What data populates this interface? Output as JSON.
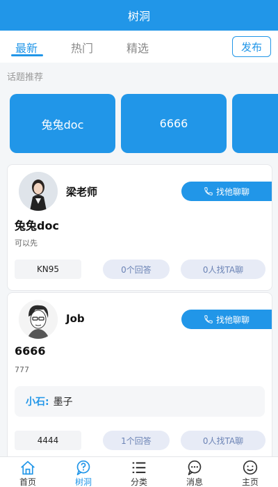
{
  "header": {
    "title": "树洞"
  },
  "tabs": [
    {
      "label": "最新",
      "active": true
    },
    {
      "label": "热门",
      "active": false
    },
    {
      "label": "精选",
      "active": false
    }
  ],
  "publish_label": "发布",
  "topics": {
    "label": "话题推荐",
    "items": [
      "兔兔doc",
      "6666",
      ""
    ]
  },
  "posts": [
    {
      "user": "梁老师",
      "chat_label": "找他聊聊",
      "title": "兔兔doc",
      "desc": "可以先",
      "tag": "KN95",
      "answers": "0个回答",
      "talk": "0人找TA聊"
    },
    {
      "user": "Job",
      "chat_label": "找他聊聊",
      "title": "6666",
      "desc": "777",
      "reply_name": "小石:",
      "reply_text": "墨子",
      "tag": "4444",
      "answers": "1个回答",
      "talk": "0人找TA聊"
    }
  ],
  "nav": [
    {
      "label": "首页",
      "icon": "home-icon"
    },
    {
      "label": "树洞",
      "icon": "question-bubble-icon",
      "active": true
    },
    {
      "label": "分类",
      "icon": "list-icon"
    },
    {
      "label": "消息",
      "icon": "message-icon"
    },
    {
      "label": "主页",
      "icon": "profile-face-icon"
    }
  ],
  "colors": {
    "primary": "#2196e8",
    "pill_bg": "#e7ebf6",
    "pill_text": "#6b83b5"
  }
}
